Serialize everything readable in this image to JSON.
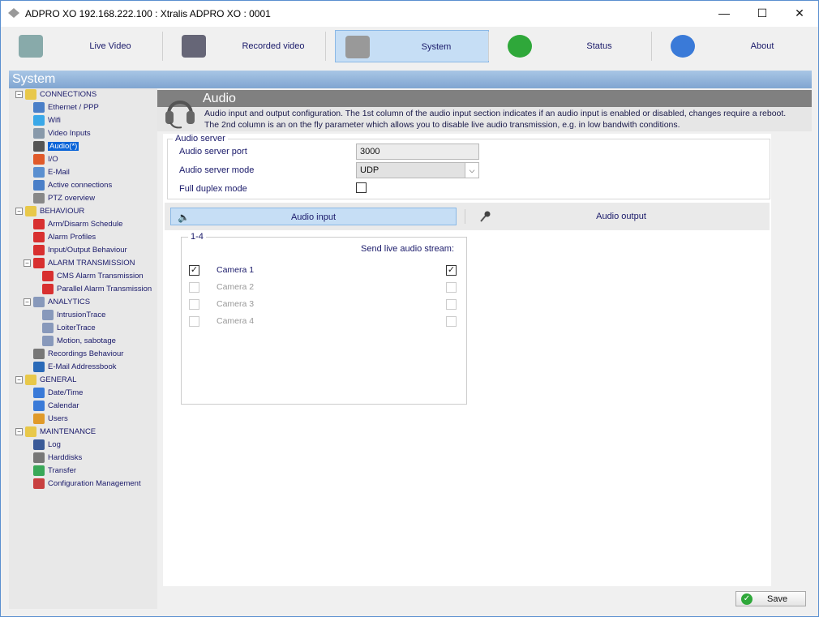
{
  "window": {
    "title": "ADPRO XO  192.168.222.100 : Xtralis ADPRO XO : 0001",
    "controls": [
      "—",
      "☐",
      "✕"
    ]
  },
  "toolbar": [
    {
      "label": "Live Video",
      "icon": "camera-icon"
    },
    {
      "label": "Recorded video",
      "icon": "film-reel-icon"
    },
    {
      "label": "System",
      "icon": "wrench-icon",
      "selected": true
    },
    {
      "label": "Status",
      "icon": "lock-icon"
    },
    {
      "label": "About",
      "icon": "info-icon"
    }
  ],
  "section_title": "System",
  "tree": [
    {
      "label": "CONNECTIONS",
      "level": 0,
      "group": true,
      "color": "#e8c84a"
    },
    {
      "label": "Ethernet / PPP",
      "level": 1,
      "color": "#4a7fc8"
    },
    {
      "label": "Wifi",
      "level": 1,
      "color": "#3aa8e8"
    },
    {
      "label": "Video Inputs",
      "level": 1,
      "color": "#8899aa"
    },
    {
      "label": "Audio(*)",
      "level": 1,
      "selected": true,
      "color": "#555555"
    },
    {
      "label": "I/O",
      "level": 1,
      "color": "#e05a2a"
    },
    {
      "label": "E-Mail",
      "level": 1,
      "color": "#5a8fd0"
    },
    {
      "label": "Active connections",
      "level": 1,
      "color": "#4a7fc8"
    },
    {
      "label": "PTZ overview",
      "level": 1,
      "color": "#888888"
    },
    {
      "label": "BEHAVIOUR",
      "level": 0,
      "group": true,
      "color": "#e8c84a"
    },
    {
      "label": "Arm/Disarm Schedule",
      "level": 1,
      "color": "#d83030"
    },
    {
      "label": "Alarm Profiles",
      "level": 1,
      "color": "#d83030"
    },
    {
      "label": "Input/Output Behaviour",
      "level": 1,
      "color": "#d83030"
    },
    {
      "label": "ALARM TRANSMISSION",
      "level": 1,
      "group": true,
      "color": "#d83030"
    },
    {
      "label": "CMS Alarm Transmission",
      "level": 2,
      "color": "#d83030"
    },
    {
      "label": "Parallel Alarm Transmission",
      "level": 2,
      "color": "#d83030"
    },
    {
      "label": "ANALYTICS",
      "level": 1,
      "group": true,
      "color": "#8899bb"
    },
    {
      "label": "IntrusionTrace",
      "level": 2,
      "color": "#8899bb"
    },
    {
      "label": "LoiterTrace",
      "level": 2,
      "color": "#8899bb"
    },
    {
      "label": "Motion, sabotage",
      "level": 2,
      "color": "#8899bb"
    },
    {
      "label": "Recordings Behaviour",
      "level": 1,
      "color": "#777777"
    },
    {
      "label": "E-Mail Addressbook",
      "level": 1,
      "color": "#2a6ab8"
    },
    {
      "label": "GENERAL",
      "level": 0,
      "group": true,
      "color": "#e8c84a"
    },
    {
      "label": "Date/Time",
      "level": 1,
      "color": "#3a7ad8"
    },
    {
      "label": "Calendar",
      "level": 1,
      "color": "#3a7ad8"
    },
    {
      "label": "Users",
      "level": 1,
      "color": "#e09a2a"
    },
    {
      "label": "MAINTENANCE",
      "level": 0,
      "group": true,
      "color": "#e8c84a"
    },
    {
      "label": "Log",
      "level": 1,
      "color": "#3a5a98"
    },
    {
      "label": "Harddisks",
      "level": 1,
      "color": "#777777"
    },
    {
      "label": "Transfer",
      "level": 1,
      "color": "#3aa858"
    },
    {
      "label": "Configuration Management",
      "level": 1,
      "color": "#c84040"
    }
  ],
  "page": {
    "title": "Audio",
    "description_1": "Audio input and output configuration. The 1st column of the audio input section indicates if an audio input is enabled or disabled, changes require a reboot.",
    "description_2": "The 2nd column is an on the fly parameter which allows you to disable live audio transmission, e.g. in low bandwith conditions."
  },
  "server": {
    "legend": "Audio server",
    "port_label": "Audio server port",
    "port_value": "3000",
    "mode_label": "Audio server mode",
    "mode_value": "UDP",
    "duplex_label": "Full duplex mode",
    "duplex_checked": false
  },
  "tabs": [
    {
      "label": "Audio input",
      "selected": true
    },
    {
      "label": "Audio output"
    }
  ],
  "inputs": {
    "group": "1-4",
    "send_header": "Send live audio stream:",
    "cameras": [
      {
        "name": "Camera 1",
        "enabled": true,
        "send": true,
        "active": true
      },
      {
        "name": "Camera 2",
        "enabled": false,
        "send": false,
        "active": false
      },
      {
        "name": "Camera 3",
        "enabled": false,
        "send": false,
        "active": false
      },
      {
        "name": "Camera 4",
        "enabled": false,
        "send": false,
        "active": false
      }
    ]
  },
  "save_label": "Save"
}
